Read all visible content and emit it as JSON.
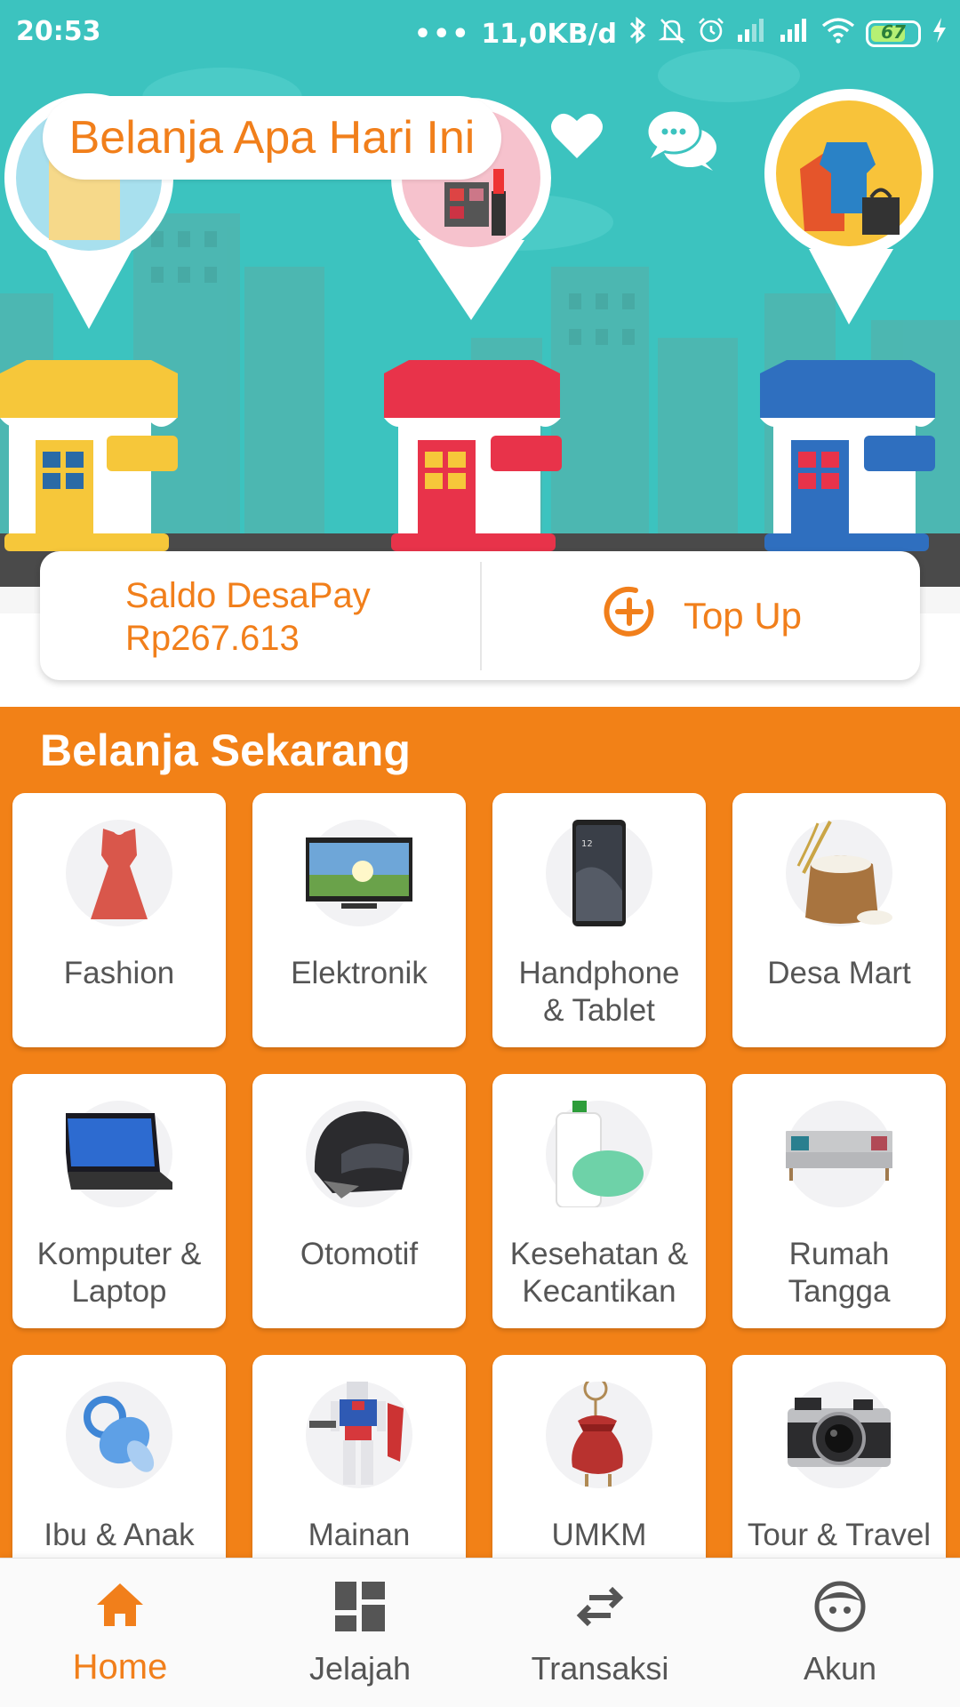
{
  "status_bar": {
    "time": "20:53",
    "dots": "•••",
    "network_speed": "11,0KB/d",
    "battery_level": "67"
  },
  "header": {
    "search_text": "Belanja Apa Hari Ini"
  },
  "balance": {
    "label": "Saldo DesaPay",
    "amount": "Rp267.613",
    "topup_label": "Top Up"
  },
  "shop": {
    "title": "Belanja Sekarang",
    "categories": [
      {
        "label": "Fashion",
        "icon": "dress-icon"
      },
      {
        "label": "Elektronik",
        "icon": "tv-icon"
      },
      {
        "label": "Handphone\n& Tablet",
        "icon": "smartphone-icon"
      },
      {
        "label": "Desa Mart",
        "icon": "rice-sack-icon"
      },
      {
        "label": "Komputer &\nLaptop",
        "icon": "laptop-icon"
      },
      {
        "label": "Otomotif",
        "icon": "helmet-icon"
      },
      {
        "label": "Kesehatan &\nKecantikan",
        "icon": "soap-bottle-icon"
      },
      {
        "label": "Rumah\nTangga",
        "icon": "sofa-icon"
      },
      {
        "label": "Ibu & Anak",
        "icon": "pacifier-icon"
      },
      {
        "label": "Mainan",
        "icon": "robot-toy-icon"
      },
      {
        "label": "UMKM",
        "icon": "pouch-icon"
      },
      {
        "label": "Tour & Travel",
        "icon": "camera-icon"
      }
    ]
  },
  "bottom_nav": {
    "items": [
      {
        "label": "Home",
        "icon": "home-icon",
        "active": true
      },
      {
        "label": "Jelajah",
        "icon": "dashboard-icon",
        "active": false
      },
      {
        "label": "Transaksi",
        "icon": "swap-arrows-icon",
        "active": false
      },
      {
        "label": "Akun",
        "icon": "face-icon",
        "active": false
      }
    ]
  },
  "colors": {
    "brand_orange": "#f28117",
    "hero_teal": "#3cc3bf",
    "text_gray": "#555555"
  }
}
